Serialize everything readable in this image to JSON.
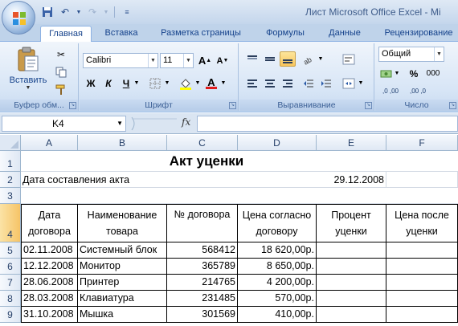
{
  "window": {
    "title": "Лист Microsoft Office Excel - Mi"
  },
  "ribbon_tabs": [
    "Главная",
    "Вставка",
    "Разметка страницы",
    "Формулы",
    "Данные",
    "Рецензирование"
  ],
  "ribbon": {
    "paste_label": "Вставить",
    "clipboard_group": "Буфер обм...",
    "font_name": "Calibri",
    "font_size": "11",
    "bold": "Ж",
    "italic": "К",
    "underline": "Ч",
    "grow_font": "A",
    "shrink_font": "A",
    "font_color_letter": "A",
    "font_group": "Шрифт",
    "alignment_group": "Выравнивание",
    "number_format": "Общий",
    "percent": "%",
    "thousands": "000",
    "inc_decimal": ",0 ,00",
    "dec_decimal": ",00 ,0",
    "number_group": "Число"
  },
  "formula_bar": {
    "cell_ref": "K4",
    "fx": "fx",
    "value": ""
  },
  "sheet": {
    "columns": [
      "A",
      "B",
      "C",
      "D",
      "E",
      "F"
    ],
    "rows": [
      "1",
      "2",
      "3",
      "4",
      "5",
      "6",
      "7",
      "8",
      "9"
    ],
    "title": "Акт уценки",
    "date_label": "Дата составления акта",
    "date_value": "29.12.2008",
    "headers": [
      "Дата договора",
      "Наименование товара",
      "№ договора",
      "Цена согласно договору",
      "Процент уценки",
      "Цена после уценки"
    ],
    "data": [
      [
        "02.11.2008",
        "Системный блок",
        "568412",
        "18 620,00р.",
        "",
        ""
      ],
      [
        "12.12.2008",
        "Монитор",
        "365789",
        "8 650,00р.",
        "",
        ""
      ],
      [
        "28.06.2008",
        "Принтер",
        "214765",
        "4 200,00р.",
        "",
        ""
      ],
      [
        "28.03.2008",
        "Клавиатура",
        "231485",
        "570,00р.",
        "",
        ""
      ],
      [
        "31.10.2008",
        "Мышка",
        "301569",
        "410,00р.",
        "",
        ""
      ]
    ]
  },
  "colors": {
    "ribbon_blue": "#15428b",
    "selection_gold": "#f6c467"
  }
}
